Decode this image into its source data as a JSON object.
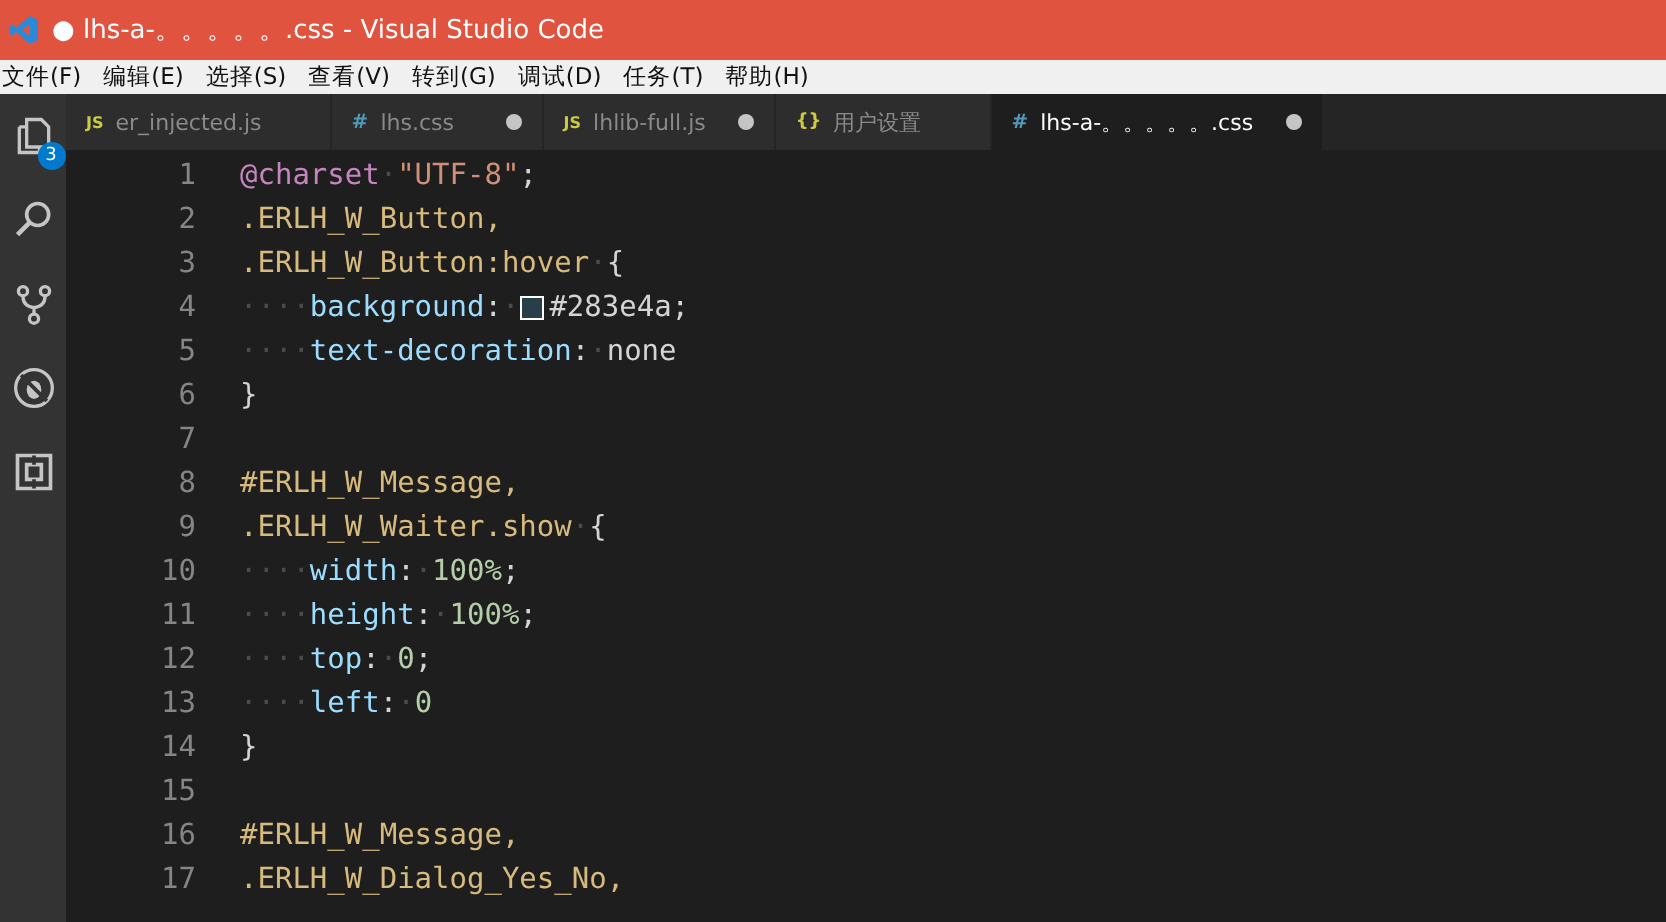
{
  "window": {
    "title": "● lhs-a-。。。。。.css - Visual Studio Code"
  },
  "menu": [
    "文件(F)",
    "编辑(E)",
    "选择(S)",
    "查看(V)",
    "转到(G)",
    "调试(D)",
    "任务(T)",
    "帮助(H)"
  ],
  "activity_bar": [
    {
      "kind": "files",
      "badge": "3"
    },
    {
      "kind": "search"
    },
    {
      "kind": "git"
    },
    {
      "kind": "debug"
    },
    {
      "kind": "extensions"
    }
  ],
  "tabs": [
    {
      "label": "er_injected.js",
      "icon": "JS",
      "kind": "js",
      "modified": false,
      "selected": false
    },
    {
      "label": "lhs.css",
      "icon": "#",
      "kind": "css",
      "modified": true,
      "selected": false
    },
    {
      "label": "lhlib-full.js",
      "icon": "JS",
      "kind": "js",
      "modified": true,
      "selected": false
    },
    {
      "label": "用户设置",
      "icon": "{}",
      "kind": "json",
      "modified": false,
      "selected": false
    },
    {
      "label": "lhs-a-。。。。。.css",
      "icon": "#",
      "kind": "css",
      "modified": true,
      "selected": true
    }
  ],
  "editor": {
    "lines": [
      {
        "number": "1",
        "tokens": [
          {
            "kind": "keyword",
            "text": "@charset"
          },
          {
            "kind": "ws",
            "text": "·"
          },
          {
            "kind": "string",
            "text": "\"UTF-8\""
          },
          {
            "kind": "punct",
            "text": ";"
          }
        ]
      },
      {
        "number": "2",
        "tokens": [
          {
            "kind": "selector",
            "text": ".ERLH_W_Button,"
          }
        ]
      },
      {
        "number": "3",
        "tokens": [
          {
            "kind": "selector",
            "text": ".ERLH_W_Button:hover"
          },
          {
            "kind": "ws",
            "text": "·"
          },
          {
            "kind": "punct",
            "text": "{"
          }
        ]
      },
      {
        "number": "4",
        "tokens": [
          {
            "kind": "ws",
            "text": "····"
          },
          {
            "kind": "property",
            "text": "background"
          },
          {
            "kind": "punct",
            "text": ":"
          },
          {
            "kind": "ws",
            "text": "·"
          },
          {
            "kind": "swatch",
            "color": "#283e4a"
          },
          {
            "kind": "punct",
            "text": "#283e4a;"
          }
        ]
      },
      {
        "number": "5",
        "tokens": [
          {
            "kind": "ws",
            "text": "····"
          },
          {
            "kind": "property",
            "text": "text-decoration"
          },
          {
            "kind": "punct",
            "text": ":"
          },
          {
            "kind": "ws",
            "text": "·"
          },
          {
            "kind": "punct",
            "text": "none"
          }
        ]
      },
      {
        "number": "6",
        "tokens": [
          {
            "kind": "punct",
            "text": "}"
          }
        ]
      },
      {
        "number": "7"
      },
      {
        "number": "8",
        "tokens": [
          {
            "kind": "selector",
            "text": "#ERLH_W_Message,"
          }
        ]
      },
      {
        "number": "9",
        "tokens": [
          {
            "kind": "selector",
            "text": ".ERLH_W_Waiter.show"
          },
          {
            "kind": "ws",
            "text": "·"
          },
          {
            "kind": "punct",
            "text": "{"
          }
        ]
      },
      {
        "number": "10",
        "tokens": [
          {
            "kind": "ws",
            "text": "····"
          },
          {
            "kind": "property",
            "text": "width"
          },
          {
            "kind": "punct",
            "text": ":"
          },
          {
            "kind": "ws",
            "text": "·"
          },
          {
            "kind": "number",
            "text": "100%"
          },
          {
            "kind": "punct",
            "text": ";"
          }
        ]
      },
      {
        "number": "11",
        "tokens": [
          {
            "kind": "ws",
            "text": "····"
          },
          {
            "kind": "property",
            "text": "height"
          },
          {
            "kind": "punct",
            "text": ":"
          },
          {
            "kind": "ws",
            "text": "·"
          },
          {
            "kind": "number",
            "text": "100%"
          },
          {
            "kind": "punct",
            "text": ";"
          }
        ]
      },
      {
        "number": "12",
        "tokens": [
          {
            "kind": "ws",
            "text": "····"
          },
          {
            "kind": "property",
            "text": "top"
          },
          {
            "kind": "punct",
            "text": ":"
          },
          {
            "kind": "ws",
            "text": "·"
          },
          {
            "kind": "number",
            "text": "0"
          },
          {
            "kind": "punct",
            "text": ";"
          }
        ]
      },
      {
        "number": "13",
        "tokens": [
          {
            "kind": "ws",
            "text": "····"
          },
          {
            "kind": "property",
            "text": "left"
          },
          {
            "kind": "punct",
            "text": ":"
          },
          {
            "kind": "ws",
            "text": "·"
          },
          {
            "kind": "number",
            "text": "0"
          }
        ]
      },
      {
        "number": "14",
        "tokens": [
          {
            "kind": "punct",
            "text": "}"
          }
        ]
      },
      {
        "number": "15"
      },
      {
        "number": "16",
        "tokens": [
          {
            "kind": "selector",
            "text": "#ERLH_W_Message,"
          }
        ]
      },
      {
        "number": "17",
        "tokens": [
          {
            "kind": "selector",
            "text": ".ERLH_W_Dialog_Yes_No,"
          }
        ]
      }
    ]
  }
}
